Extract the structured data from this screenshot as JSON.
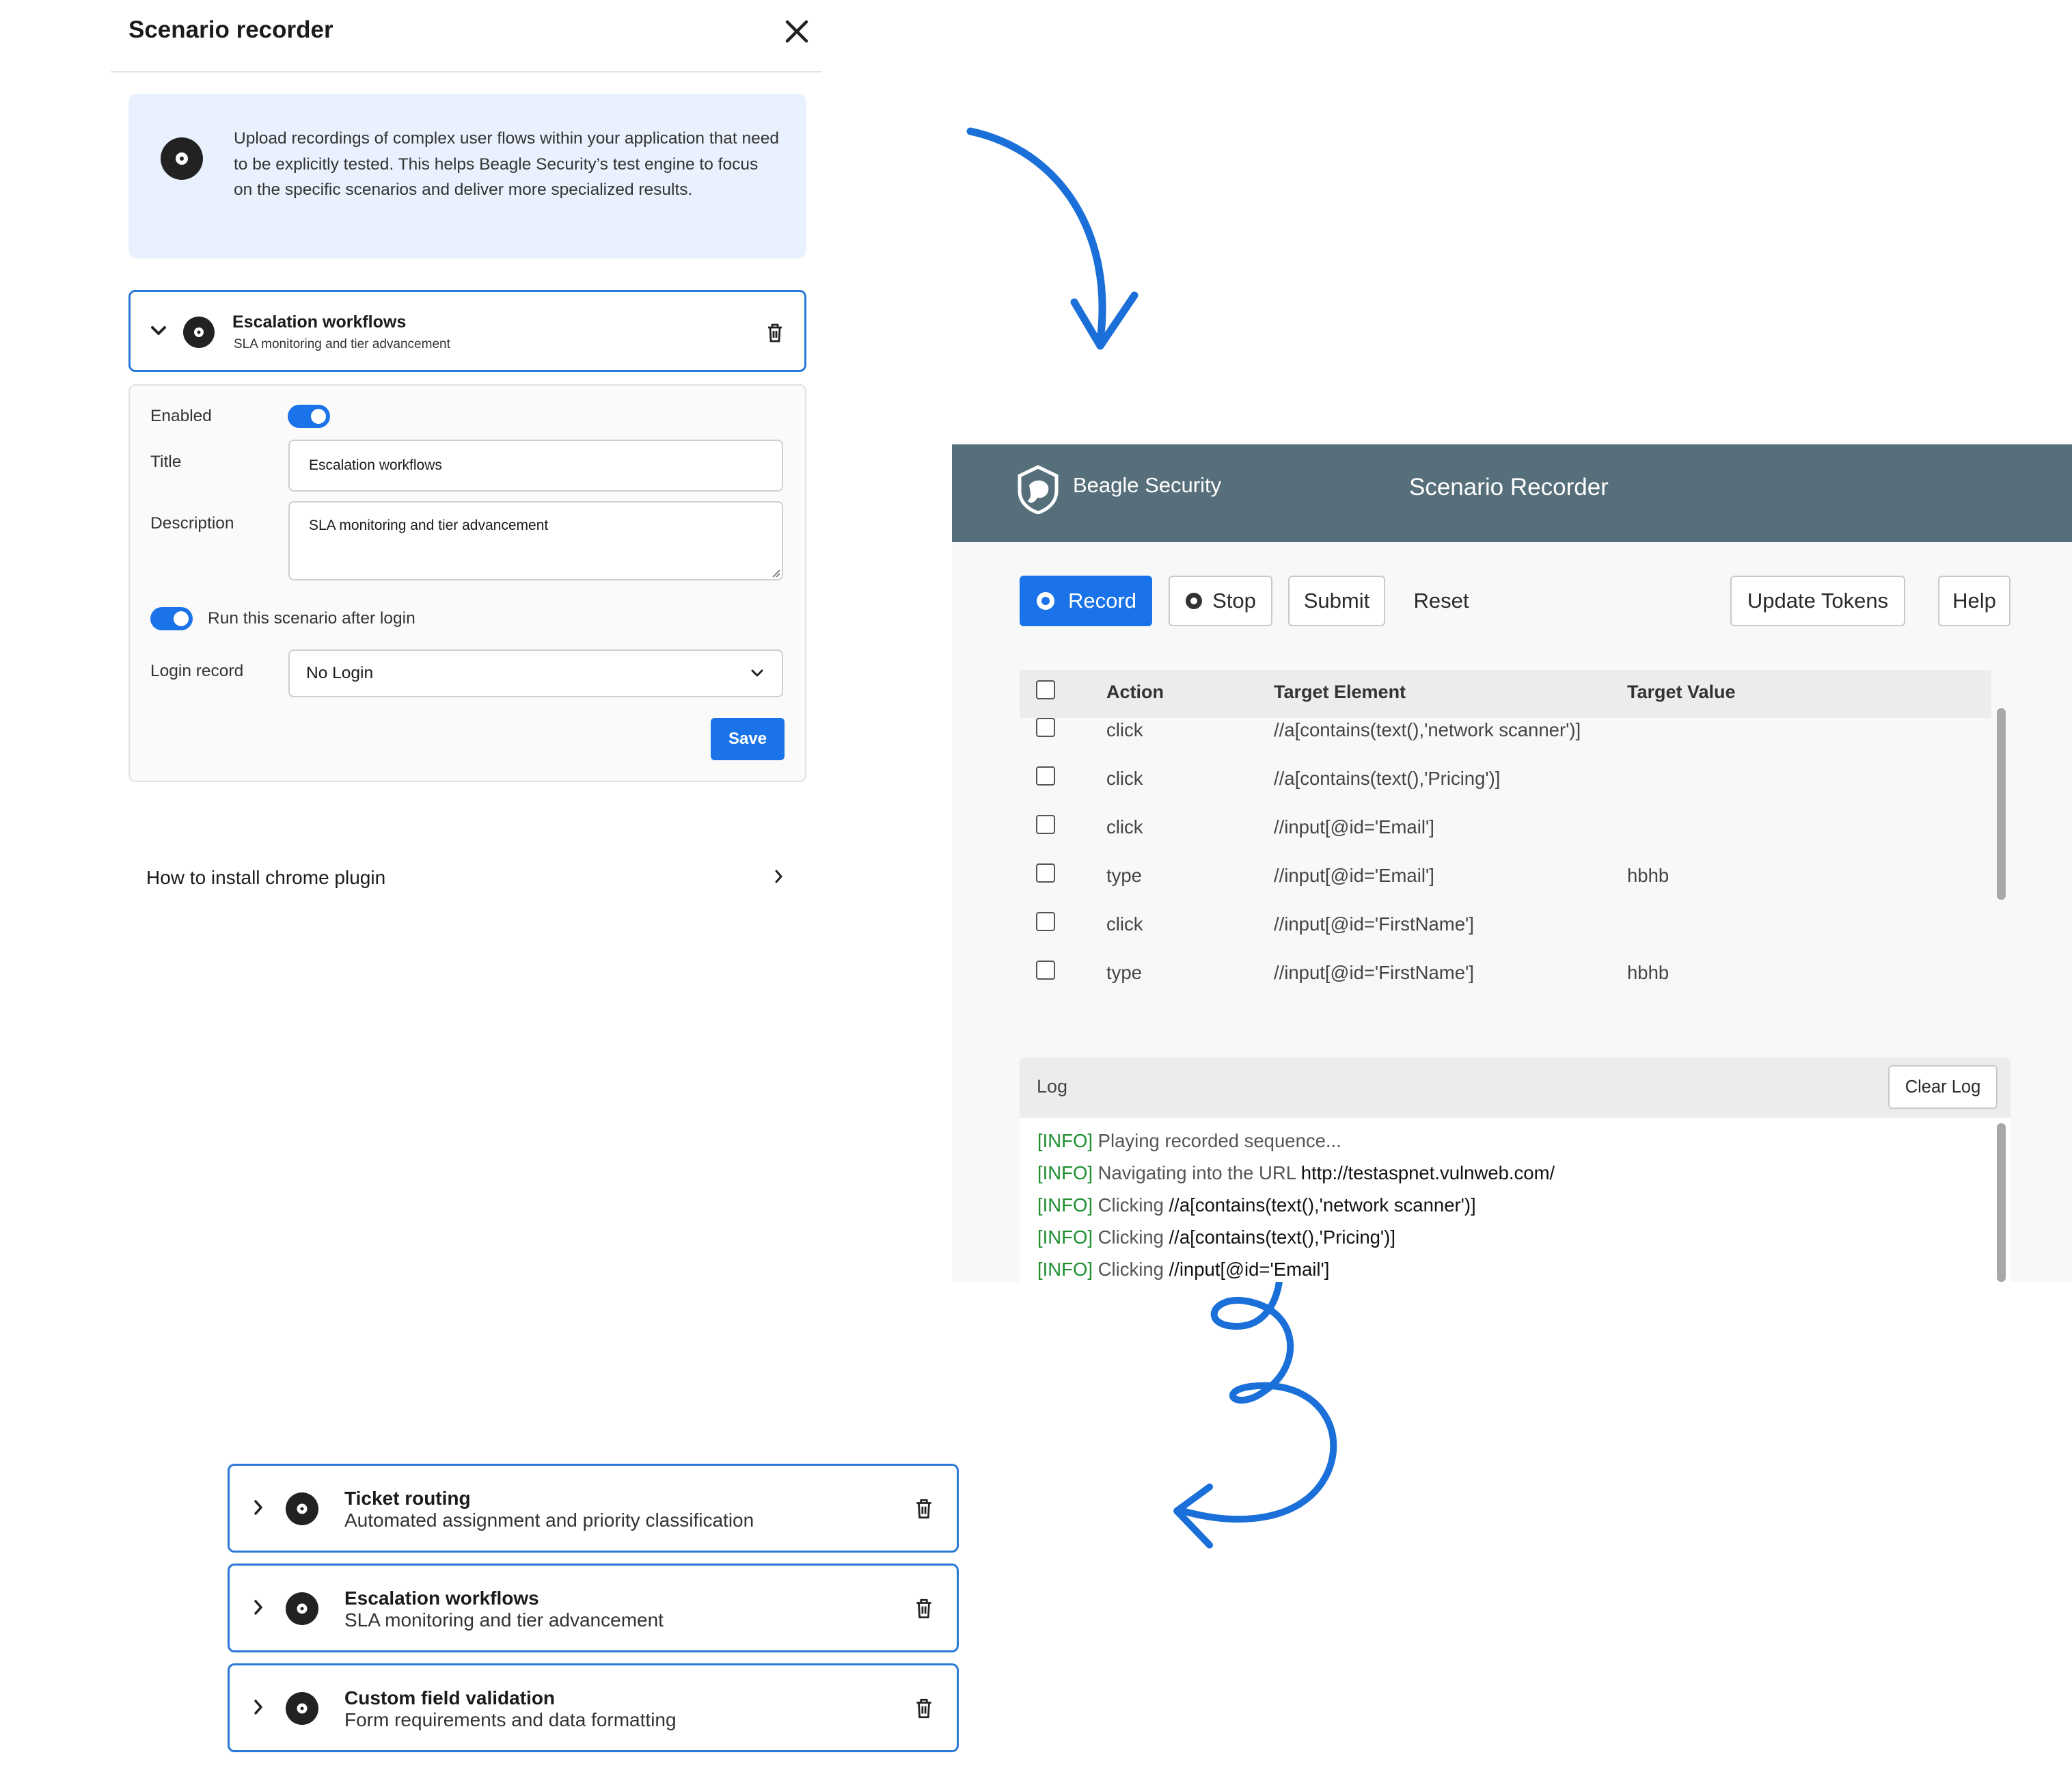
{
  "drawer": {
    "title": "Scenario recorder",
    "info_text": "Upload recordings of complex user flows within your application that need to be explicitly tested. This helps Beagle Security’s test engine to focus on the specific scenarios and deliver more specialized results."
  },
  "active_scenario": {
    "title": "Escalation workflows",
    "subtitle": "SLA monitoring and tier advancement"
  },
  "form": {
    "enabled_label": "Enabled",
    "enabled": true,
    "title_label": "Title",
    "title_value": "Escalation workflows",
    "description_label": "Description",
    "description_value": "SLA monitoring and tier advancement",
    "run_after_login_label": "Run this scenario after login",
    "run_after_login": true,
    "login_record_label": "Login record",
    "login_record_value": "No Login",
    "save_label": "Save"
  },
  "plugin_link": "How to install chrome plugin",
  "recorder": {
    "brand": "Beagle Security",
    "title": "Scenario Recorder",
    "buttons": {
      "record": "Record",
      "stop": "Stop",
      "submit": "Submit",
      "reset": "Reset",
      "update_tokens": "Update Tokens",
      "help": "Help"
    },
    "columns": [
      "Action",
      "Target Element",
      "Target Value"
    ],
    "rows": [
      {
        "action": "click",
        "target": "//a[contains(text(),'network scanner')]",
        "value": ""
      },
      {
        "action": "click",
        "target": "//a[contains(text(),'Pricing')]",
        "value": ""
      },
      {
        "action": "click",
        "target": "//input[@id='Email']",
        "value": ""
      },
      {
        "action": "type",
        "target": "//input[@id='Email']",
        "value": "hbhb"
      },
      {
        "action": "click",
        "target": "//input[@id='FirstName']",
        "value": ""
      },
      {
        "action": "type",
        "target": "//input[@id='FirstName']",
        "value": "hbhb"
      }
    ],
    "log_label": "Log",
    "clear_log_label": "Clear Log",
    "log_lines": [
      {
        "tag": "[INFO]",
        "text": "Playing recorded sequence...",
        "value": ""
      },
      {
        "tag": "[INFO]",
        "text": "Navigating into the URL",
        "value": "http://testaspnet.vulnweb.com/"
      },
      {
        "tag": "[INFO]",
        "text": "Clicking",
        "value": "//a[contains(text(),'network scanner')]"
      },
      {
        "tag": "[INFO]",
        "text": "Clicking",
        "value": "//a[contains(text(),'Pricing')]"
      },
      {
        "tag": "[INFO]",
        "text": "Clicking",
        "value": "//input[@id='Email']"
      }
    ]
  },
  "scenario_cards": [
    {
      "title": "Ticket routing",
      "subtitle": "Automated assignment and priority classification"
    },
    {
      "title": "Escalation workflows",
      "subtitle": "SLA monitoring and tier advancement"
    },
    {
      "title": "Custom field validation",
      "subtitle": "Form requirements and data formatting"
    }
  ],
  "colors": {
    "accent": "#1a73e8",
    "header_bg": "#566f7a",
    "info_bg": "#e8f1fd",
    "card_border": "#2a78d8",
    "log_tag": "#1e8f2e",
    "arrow": "#1a6fd8"
  }
}
